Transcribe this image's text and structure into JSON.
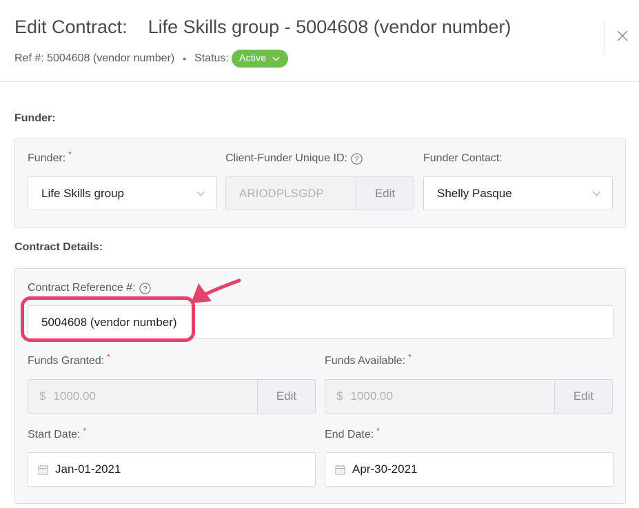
{
  "header": {
    "title_prefix": "Edit Contract:",
    "contract_name": "Life Skills group - 5004608 (vendor number)",
    "ref": "Ref #: 5004608 (vendor number)",
    "separator": "•",
    "status_label": "Status:",
    "status_value": "Active"
  },
  "funder_section": {
    "title": "Funder:",
    "funder_label": "Funder:",
    "funder_value": "Life Skills group",
    "unique_id_label": "Client-Funder Unique ID:",
    "unique_id_value": "ARIODPLSGDP",
    "unique_id_edit": "Edit",
    "contact_label": "Funder Contact:",
    "contact_value": "Shelly Pasque"
  },
  "contract_section": {
    "title": "Contract Details:",
    "reference_label": "Contract Reference #:",
    "reference_value": "5004608 (vendor number)",
    "funds_granted_label": "Funds Granted:",
    "funds_granted_currency": "$",
    "funds_granted_value": "1000.00",
    "funds_granted_edit": "Edit",
    "funds_available_label": "Funds Available:",
    "funds_available_currency": "$",
    "funds_available_value": "1000.00",
    "funds_available_edit": "Edit",
    "start_label": "Start Date:",
    "start_value": "Jan-01-2021",
    "end_label": "End Date:",
    "end_value": "Apr-30-2021"
  },
  "required_marker": "*",
  "colors": {
    "status_active": "#6cc04a",
    "required": "#e0364f",
    "annotation": "#e4416b"
  },
  "icons": [
    "close-icon",
    "chevron-down-icon",
    "help-icon",
    "calendar-icon"
  ]
}
